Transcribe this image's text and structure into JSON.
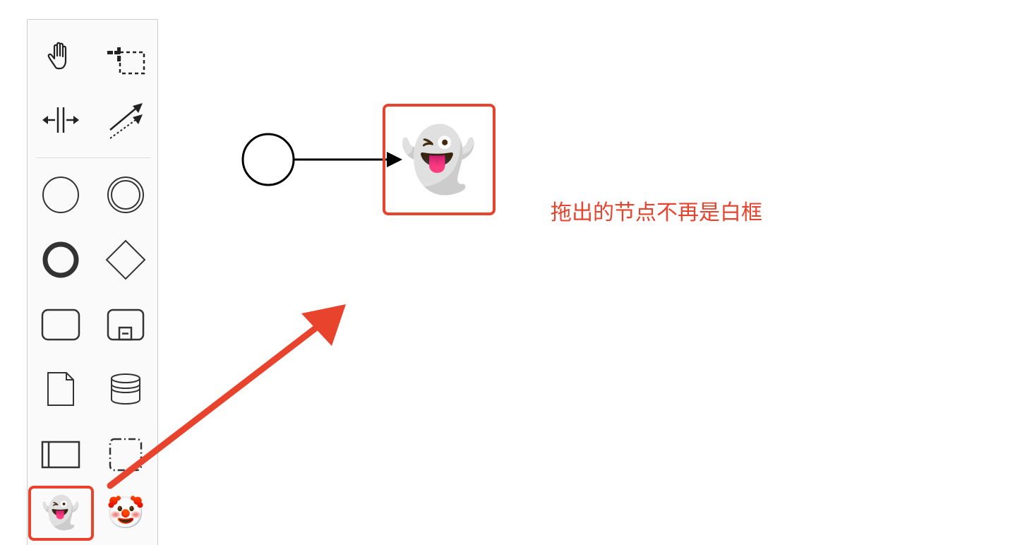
{
  "palette": {
    "tools": [
      {
        "name": "hand-tool",
        "icon": "hand-icon"
      },
      {
        "name": "lasso-tool",
        "icon": "lasso-select-icon"
      },
      {
        "name": "space-tool",
        "icon": "space-tool-icon"
      },
      {
        "name": "global-connect-tool",
        "icon": "connect-arrow-icon"
      },
      {
        "name": "create-start-event",
        "icon": "start-event-icon"
      },
      {
        "name": "create-intermediate-event",
        "icon": "intermediate-event-icon"
      },
      {
        "name": "create-end-event",
        "icon": "end-event-icon"
      },
      {
        "name": "create-gateway",
        "icon": "gateway-icon"
      },
      {
        "name": "create-task",
        "icon": "task-icon"
      },
      {
        "name": "create-subprocess",
        "icon": "subprocess-icon"
      },
      {
        "name": "create-data-object",
        "icon": "data-object-icon"
      },
      {
        "name": "create-data-store",
        "icon": "data-store-icon"
      },
      {
        "name": "create-participant",
        "icon": "participant-icon"
      },
      {
        "name": "create-group",
        "icon": "group-icon"
      }
    ],
    "custom_tools": {
      "ghost": "👻",
      "clown": "🤡"
    }
  },
  "canvas": {
    "node_emoji": "👻"
  },
  "annotation": {
    "text": "拖出的节点不再是白框",
    "color": "#e8432c"
  }
}
